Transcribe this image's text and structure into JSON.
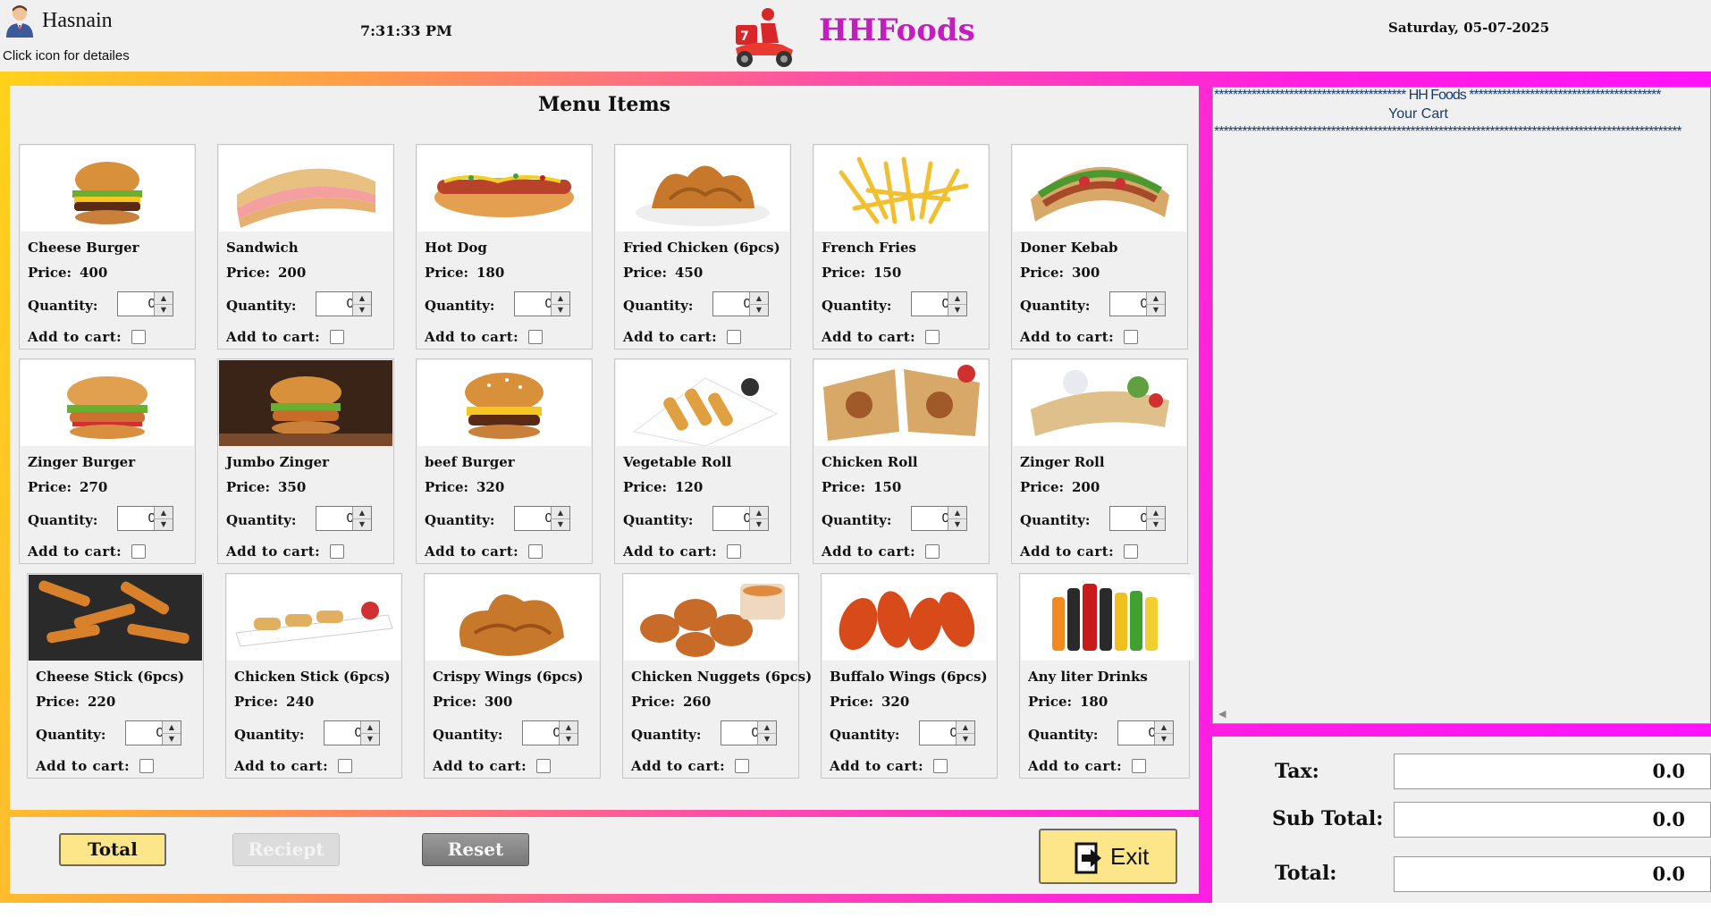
{
  "header": {
    "user_name": "Hasnain",
    "user_hint": "Click icon for detailes",
    "time": "7:31:33 PM",
    "brand": "HHFoods",
    "date": "Saturday, 05-07-2025"
  },
  "menu": {
    "title": "Menu Items",
    "price_label": "Price:",
    "quantity_label": "Quantity:",
    "add_to_cart_label": "Add to cart:",
    "items": [
      {
        "name": "Cheese Burger",
        "price": "400",
        "quantity": "0",
        "checked": false,
        "icon": "cheese-burger"
      },
      {
        "name": "Sandwich",
        "price": "200",
        "quantity": "0",
        "checked": false,
        "icon": "sandwich"
      },
      {
        "name": "Hot Dog",
        "price": "180",
        "quantity": "0",
        "checked": false,
        "icon": "hot-dog"
      },
      {
        "name": "Fried Chicken (6pcs)",
        "price": "450",
        "quantity": "0",
        "checked": false,
        "icon": "fried-chicken"
      },
      {
        "name": "French Fries",
        "price": "150",
        "quantity": "0",
        "checked": false,
        "icon": "french-fries"
      },
      {
        "name": "Doner Kebab",
        "price": "300",
        "quantity": "0",
        "checked": false,
        "icon": "doner-kebab"
      },
      {
        "name": "Zinger Burger",
        "price": "270",
        "quantity": "0",
        "checked": false,
        "icon": "zinger-burger"
      },
      {
        "name": "Jumbo Zinger",
        "price": "350",
        "quantity": "0",
        "checked": false,
        "icon": "jumbo-zinger"
      },
      {
        "name": "beef Burger",
        "price": "320",
        "quantity": "0",
        "checked": false,
        "icon": "beef-burger"
      },
      {
        "name": "Vegetable Roll",
        "price": "120",
        "quantity": "0",
        "checked": false,
        "icon": "vegetable-roll"
      },
      {
        "name": "Chicken Roll",
        "price": "150",
        "quantity": "0",
        "checked": false,
        "icon": "chicken-roll"
      },
      {
        "name": "Zinger Roll",
        "price": "200",
        "quantity": "0",
        "checked": false,
        "icon": "zinger-roll"
      },
      {
        "name": "Cheese Stick (6pcs)",
        "price": "220",
        "quantity": "0",
        "checked": false,
        "icon": "cheese-stick"
      },
      {
        "name": "Chicken Stick (6pcs)",
        "price": "240",
        "quantity": "0",
        "checked": false,
        "icon": "chicken-stick"
      },
      {
        "name": "Crispy Wings (6pcs)",
        "price": "300",
        "quantity": "0",
        "checked": false,
        "icon": "crispy-wings"
      },
      {
        "name": "Chicken Nuggets (6pcs)",
        "price": "260",
        "quantity": "0",
        "checked": false,
        "icon": "chicken-nuggets"
      },
      {
        "name": "Buffalo Wings (6pcs)",
        "price": "320",
        "quantity": "0",
        "checked": false,
        "icon": "buffalo-wings"
      },
      {
        "name": "Any liter Drinks",
        "price": "180",
        "quantity": "0",
        "checked": false,
        "icon": "drinks"
      }
    ]
  },
  "cart": {
    "header_line": "***************************************** HH Foods *****************************************",
    "title": "Your Cart",
    "divider": "****************************************************************************************************"
  },
  "buttons": {
    "total": "Total",
    "receipt": "Reciept",
    "reset": "Reset",
    "exit": "Exit"
  },
  "totals": {
    "tax_label": "Tax:",
    "tax_value": "0.0",
    "subtotal_label": "Sub Total:",
    "subtotal_value": "0.0",
    "total_label": "Total:",
    "total_value": "0.0"
  },
  "colors": {
    "brand": "#c41cc0",
    "button_yellow": "#fde58a",
    "frame_start": "#ffd21a",
    "frame_end": "#ff10ff"
  }
}
